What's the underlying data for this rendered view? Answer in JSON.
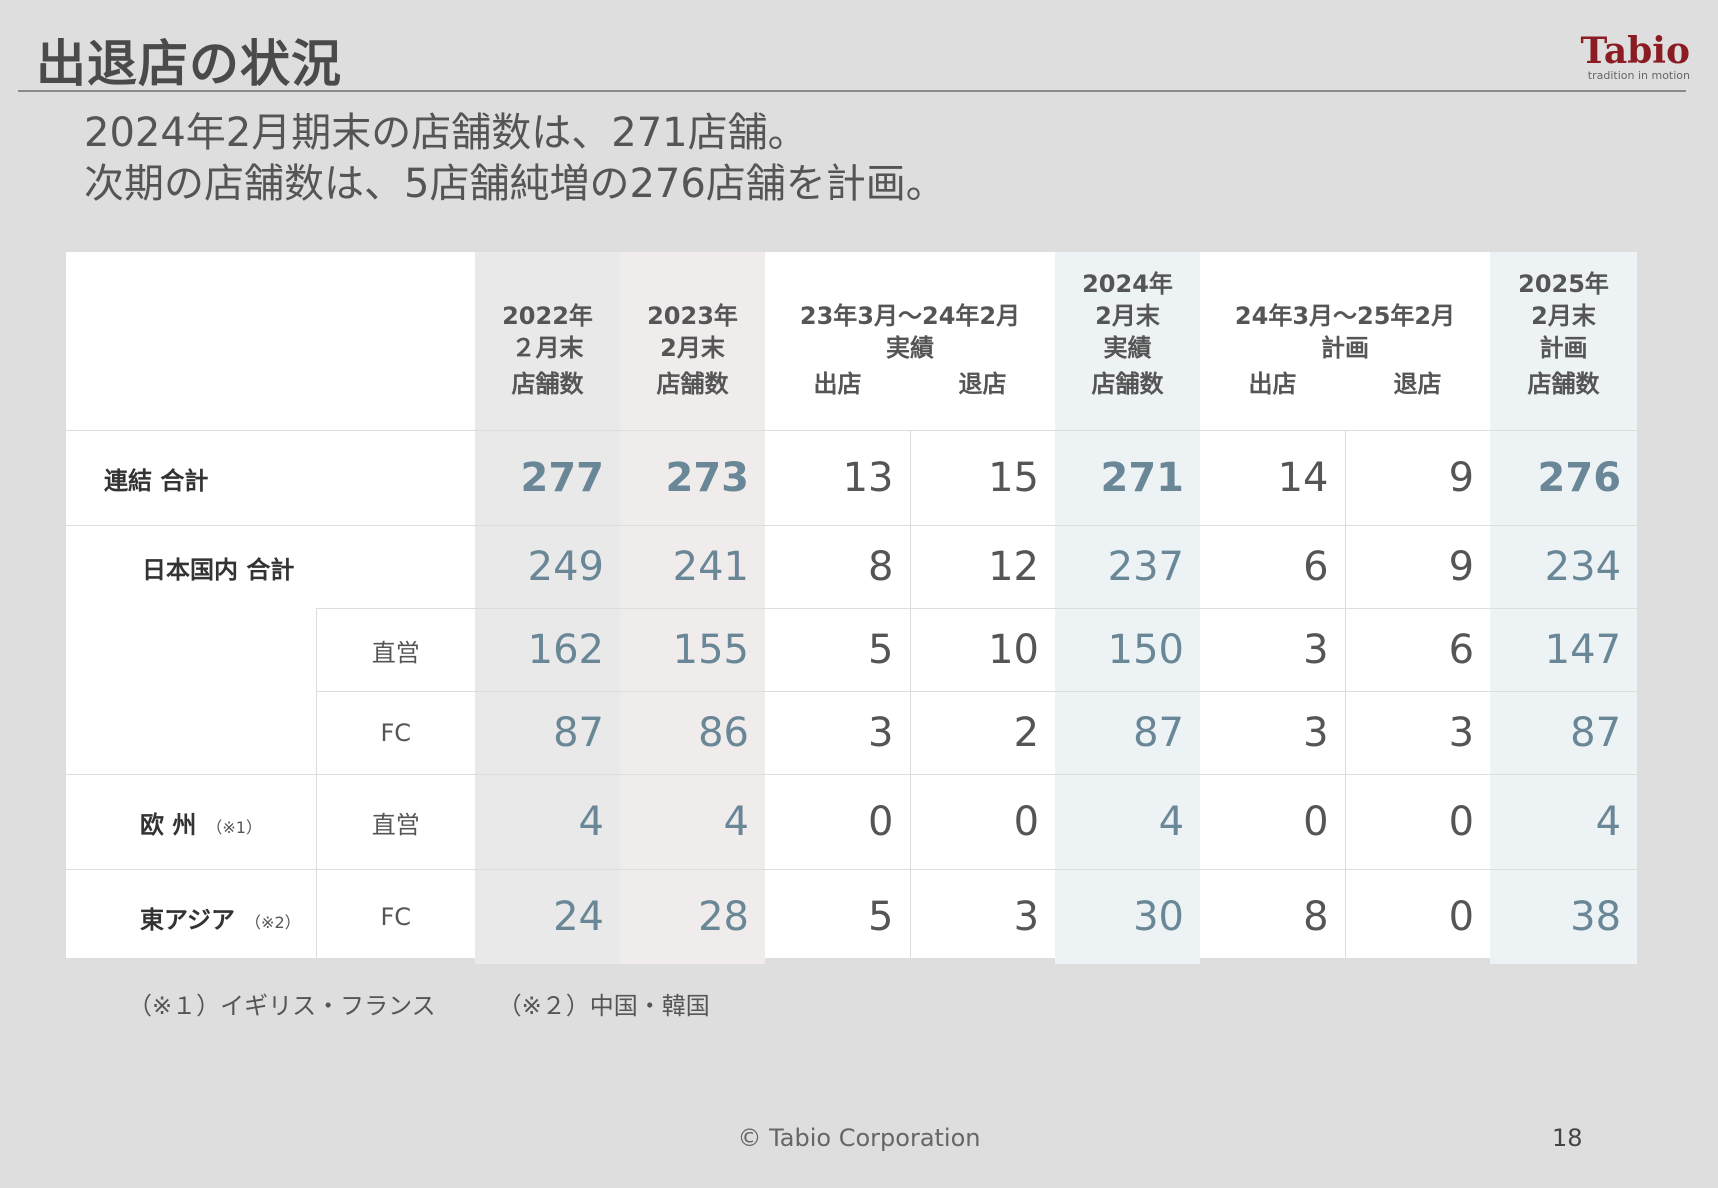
{
  "title": "出退店の状況",
  "logo": {
    "word": "Tabio",
    "tagline": "tradition in motion"
  },
  "headline": {
    "line1": "2024年2月期末の店舗数は、271店舗。",
    "line2": "次期の店舗数は、5店舗純増の276店舗を計画。"
  },
  "table": {
    "headers": {
      "c2022": "2022年\n２月末",
      "c2023": "2023年\n2月末",
      "actual_period": "23年3月～24年2月\n実績",
      "c2024": "2024年\n2月末\n実績",
      "plan_period": "24年3月～25年2月\n計画",
      "c2025": "2025年\n2月末\n計画",
      "stores": "店舗数",
      "open": "出店",
      "close": "退店"
    },
    "rows": {
      "total": {
        "label": "連結 合計",
        "values": [
          "277",
          "273",
          "13",
          "15",
          "271",
          "14",
          "9",
          "276"
        ]
      },
      "domestic": {
        "label": "日本国内 合計",
        "values": [
          "249",
          "241",
          "8",
          "12",
          "237",
          "6",
          "9",
          "234"
        ]
      },
      "dom_direct": {
        "label": "直営",
        "values": [
          "162",
          "155",
          "5",
          "10",
          "150",
          "3",
          "6",
          "147"
        ]
      },
      "dom_fc": {
        "label": "FC",
        "values": [
          "87",
          "86",
          "3",
          "2",
          "87",
          "3",
          "3",
          "87"
        ]
      },
      "europe": {
        "label": "欧 州",
        "note": "（※1）",
        "sub": "直営",
        "values": [
          "4",
          "4",
          "0",
          "0",
          "4",
          "0",
          "0",
          "4"
        ]
      },
      "east_asia": {
        "label": "東アジア",
        "note": "（※2）",
        "sub": "FC",
        "values": [
          "24",
          "28",
          "5",
          "3",
          "30",
          "8",
          "0",
          "38"
        ]
      }
    }
  },
  "footnotes": {
    "note1": "（※１）イギリス・フランス",
    "note2": "（※２）中国・韓国"
  },
  "copyright": "© Tabio Corporation",
  "page_number": "18",
  "colors": {
    "brand": "#8b1c24",
    "highlight_number": "#6a8797"
  }
}
